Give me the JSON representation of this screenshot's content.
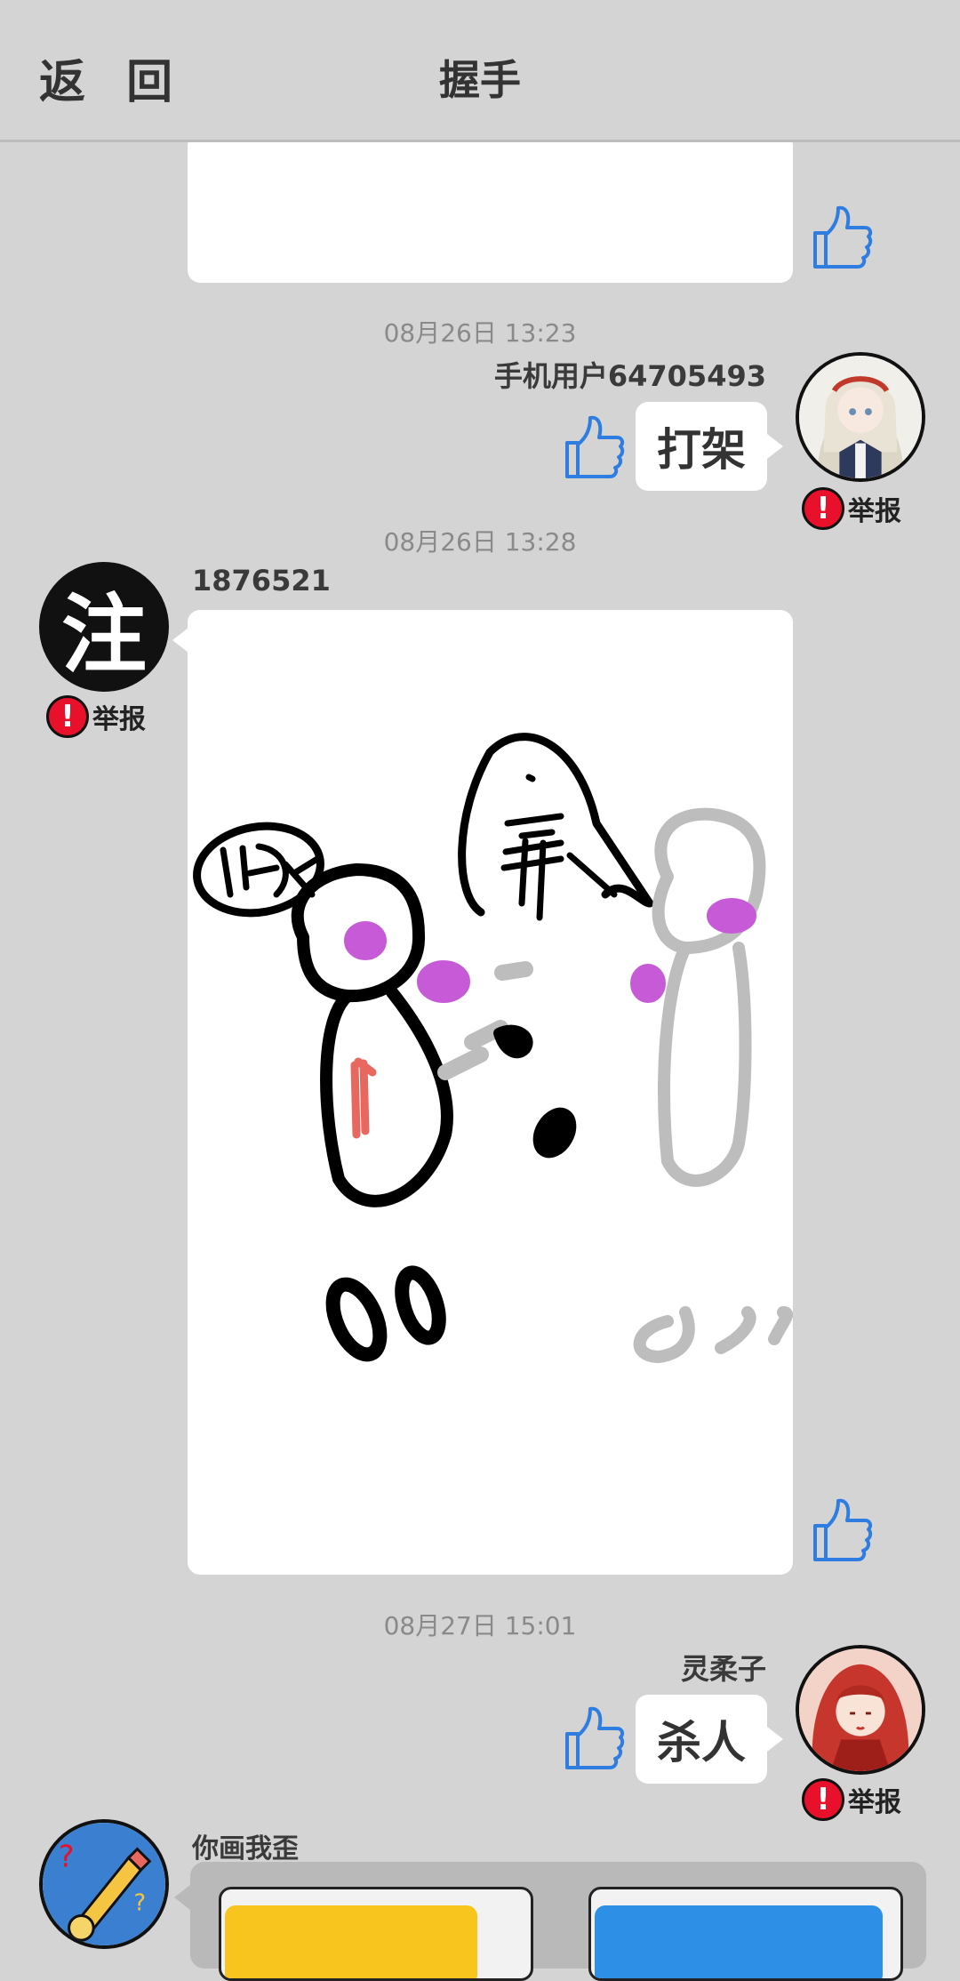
{
  "header": {
    "back_label": "返 回",
    "title": "握手"
  },
  "messages": [
    {
      "timestamp": "08月26日  13:23",
      "username": "手机用户64705493",
      "text": "打架",
      "report_label": "举报"
    },
    {
      "timestamp": "08月26日  13:28",
      "username": "1876521",
      "avatar_text": "注",
      "report_label": "举报"
    },
    {
      "timestamp": "08月27日  15:01",
      "username": "灵柔子",
      "text": "杀人",
      "report_label": "举报"
    },
    {
      "username": "你画我歪"
    }
  ],
  "icons": {
    "like": "thumbs-up-icon",
    "report": "exclamation-icon"
  },
  "colors": {
    "background": "#d4d4d4",
    "like_blue": "#2f7de1",
    "report_red": "#e8102a",
    "drawing_magenta": "#c75ad6",
    "drawing_gray": "#bdbdbd",
    "drawing_red": "#e8685f"
  }
}
